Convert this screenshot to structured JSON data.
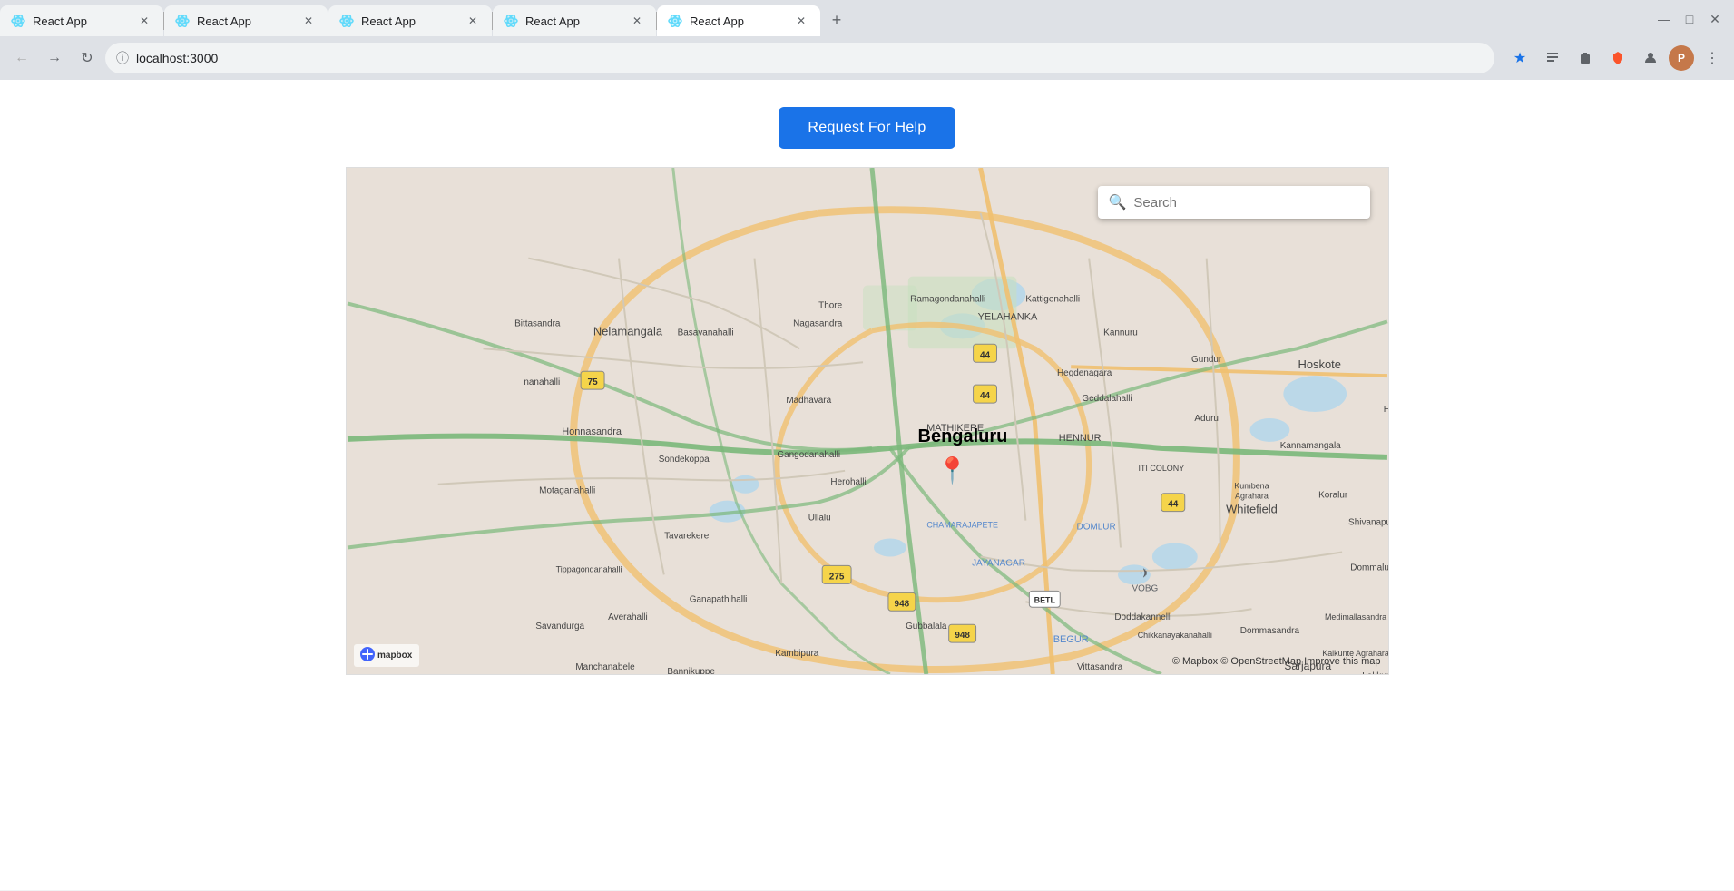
{
  "browser": {
    "tabs": [
      {
        "id": "tab1",
        "title": "React App",
        "active": false,
        "url": "localhost:3000"
      },
      {
        "id": "tab2",
        "title": "React App",
        "active": false,
        "url": "localhost:3000"
      },
      {
        "id": "tab3",
        "title": "React App",
        "active": false,
        "url": "localhost:3000"
      },
      {
        "id": "tab4",
        "title": "React App",
        "active": false,
        "url": "localhost:3000"
      },
      {
        "id": "tab5",
        "title": "React App",
        "active": true,
        "url": "localhost:3000"
      }
    ],
    "url": "localhost:3000",
    "window_controls": {
      "minimize": "—",
      "maximize": "□",
      "close": "✕"
    }
  },
  "page": {
    "request_button_label": "Request For Help",
    "map": {
      "search_placeholder": "Search",
      "city_label": "Bengaluru",
      "attribution": "© Mapbox © OpenStreetMap",
      "improve_text": "Improve this map",
      "mapbox_logo": "mapbox"
    }
  }
}
